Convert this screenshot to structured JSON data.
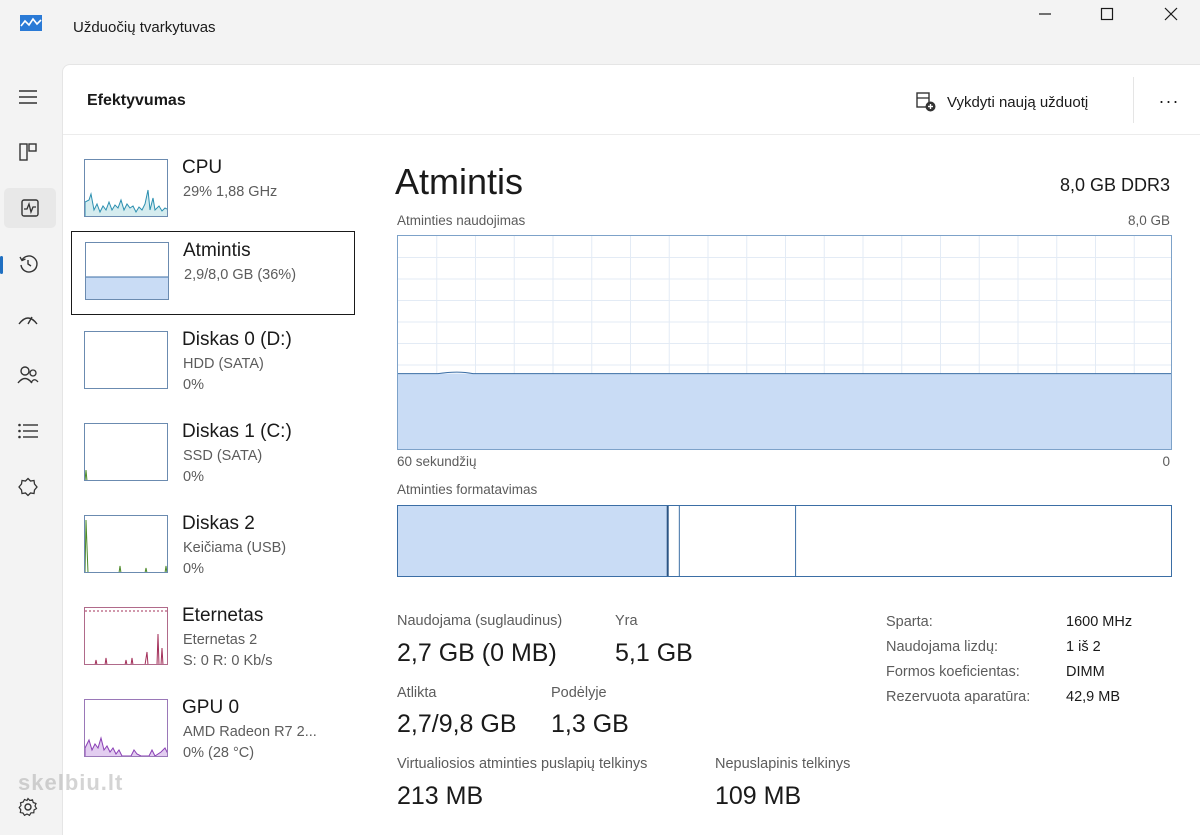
{
  "window": {
    "title": "Užduočių tvarkytuvas"
  },
  "header": {
    "page_title": "Efektyvumas",
    "run_task_label": "Vykdyti naują užduotį",
    "more_label": "···"
  },
  "nav": {
    "items": [
      {
        "icon": "hamburger-icon"
      },
      {
        "icon": "processes-icon"
      },
      {
        "icon": "performance-icon",
        "active": true
      },
      {
        "icon": "history-icon"
      },
      {
        "icon": "startup-icon"
      },
      {
        "icon": "users-icon"
      },
      {
        "icon": "details-icon"
      },
      {
        "icon": "services-icon"
      },
      {
        "icon": "settings-icon"
      }
    ]
  },
  "sidebar": {
    "items": [
      {
        "name": "CPU",
        "line1": "29% 1,88 GHz",
        "line2": ""
      },
      {
        "name": "Atmintis",
        "line1": "2,9/8,0 GB (36%)",
        "line2": "",
        "selected": true
      },
      {
        "name": "Diskas 0 (D:)",
        "line1": "HDD (SATA)",
        "line2": "0%"
      },
      {
        "name": "Diskas 1 (C:)",
        "line1": "SSD (SATA)",
        "line2": "0%"
      },
      {
        "name": "Diskas 2",
        "line1": "Keičiama (USB)",
        "line2": "0%"
      },
      {
        "name": "Eternetas",
        "line1": "Eternetas 2",
        "line2": "S: 0 R: 0 Kb/s"
      },
      {
        "name": "GPU 0",
        "line1": "AMD Radeon R7 2...",
        "line2": "0% (28 °C)"
      }
    ]
  },
  "main": {
    "title": "Atmintis",
    "spec": "8,0 GB DDR3",
    "usage_chart": {
      "label": "Atminties naudojimas",
      "max_label": "8,0 GB",
      "x_left_label": "60 sekundžių",
      "x_right_label": "0",
      "usage_fraction": 0.36
    },
    "composition": {
      "label": "Atminties formatavimas",
      "in_use_fraction": 0.348,
      "modified_fraction": 0.015,
      "standby_fraction": 0.15
    },
    "stats": {
      "in_use_label": "Naudojama (suglaudinus)",
      "in_use_value": "2,7 GB (0 MB)",
      "available_label": "Yra",
      "available_value": "5,1 GB",
      "committed_label": "Atlikta",
      "committed_value": "2,7/9,8 GB",
      "cached_label": "Podėlyje",
      "cached_value": "1,3 GB",
      "paged_label": "Virtualiosios atminties puslapių telkinys",
      "paged_value": "213 MB",
      "nonpaged_label": "Nepuslapinis telkinys",
      "nonpaged_value": "109 MB"
    },
    "specs": [
      {
        "key": "Sparta:",
        "value": "1600 MHz"
      },
      {
        "key": "Naudojama lizdų:",
        "value": "1 iš 2"
      },
      {
        "key": "Formos koeficientas:",
        "value": "DIMM"
      },
      {
        "key": "Rezervuota aparatūra:",
        "value": "42,9 MB"
      }
    ]
  },
  "watermark": "skelbiu.lt",
  "colors": {
    "accent": "#1f6fc1",
    "memory_fill": "#c9dcf5",
    "memory_line": "#3b6ea5",
    "cpu_line": "#2b8fb0",
    "disk_line": "#4e8a2a",
    "net_line": "#a3305a",
    "gpu_line": "#8a3fb5"
  }
}
